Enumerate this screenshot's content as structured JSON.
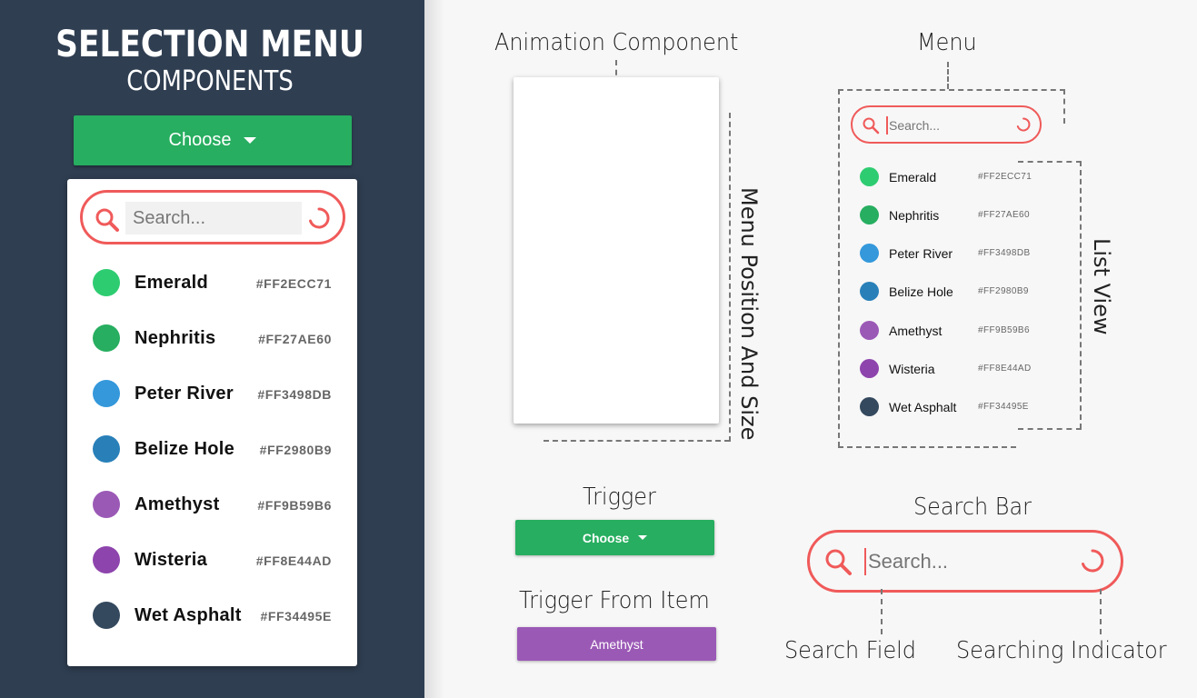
{
  "sidebar": {
    "title": "SELECTION MENU",
    "subtitle": "COMPONENTS",
    "choose_label": "Choose",
    "search_placeholder": "Search...",
    "items": [
      {
        "name": "Emerald",
        "hex": "#FF2ECC71",
        "color": "#2ecc71"
      },
      {
        "name": "Nephritis",
        "hex": "#FF27AE60",
        "color": "#27ae60"
      },
      {
        "name": "Peter River",
        "hex": "#FF3498DB",
        "color": "#3498db"
      },
      {
        "name": "Belize Hole",
        "hex": "#FF2980B9",
        "color": "#2980b9"
      },
      {
        "name": "Amethyst",
        "hex": "#FF9B59B6",
        "color": "#9b59b6"
      },
      {
        "name": "Wisteria",
        "hex": "#FF8E44AD",
        "color": "#8e44ad"
      },
      {
        "name": "Wet Asphalt",
        "hex": "#FF34495E",
        "color": "#34495e"
      }
    ]
  },
  "diagram": {
    "animation_component": "Animation Component",
    "menu_position_size": "Menu Position And Size",
    "menu": "Menu",
    "list_view": "List View",
    "search_placeholder": "Search...",
    "trigger": "Trigger",
    "trigger_button": "Choose",
    "trigger_from_item": "Trigger From Item",
    "trigger_item_button": "Amethyst",
    "search_bar": "Search Bar",
    "search_field": "Search Field",
    "searching_indicator": "Searching Indicator"
  },
  "colors": {
    "sidebar_bg": "#2f3e51",
    "accent_green": "#27ae60",
    "search_red": "#f05a5a",
    "amethyst": "#9b59b6"
  }
}
